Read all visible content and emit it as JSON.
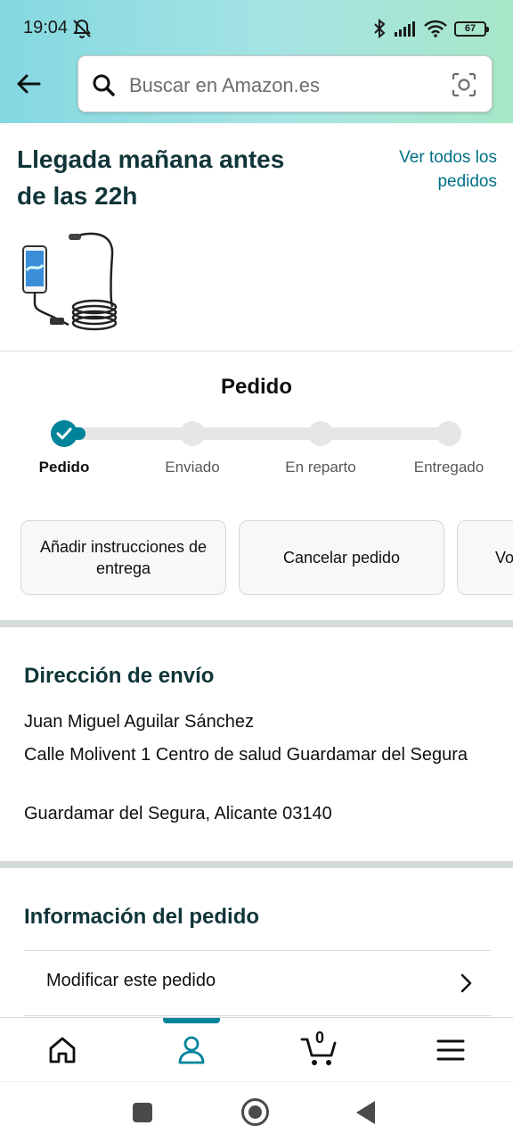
{
  "status_bar": {
    "time": "19:04",
    "battery": "67"
  },
  "search": {
    "placeholder": "Buscar en Amazon.es"
  },
  "arrival": {
    "title": "Llegada mañana antes de las 22h",
    "see_all": "Ver todos los pedidos"
  },
  "progress": {
    "title": "Pedido",
    "steps": [
      "Pedido",
      "Enviado",
      "En reparto",
      "Entregado"
    ],
    "current_step": 1
  },
  "actions": [
    "Añadir instrucciones de entrega",
    "Cancelar pedido",
    "Vo"
  ],
  "shipping": {
    "title": "Dirección de envío",
    "name": "Juan Miguel Aguilar Sánchez",
    "street": "Calle Molivent 1 Centro de salud Guardamar del Segura",
    "city": "Guardamar del Segura, Alicante 03140"
  },
  "order_info": {
    "title": "Información del pedido",
    "modify": "Modificar este pedido"
  },
  "bottom_nav": {
    "items": [
      "home-icon",
      "account-icon",
      "cart-icon",
      "menu-icon"
    ],
    "active": "account-icon",
    "cart_count": "0"
  },
  "colors": {
    "accent": "#00849a",
    "link": "#007185",
    "heading": "#0f3538"
  }
}
